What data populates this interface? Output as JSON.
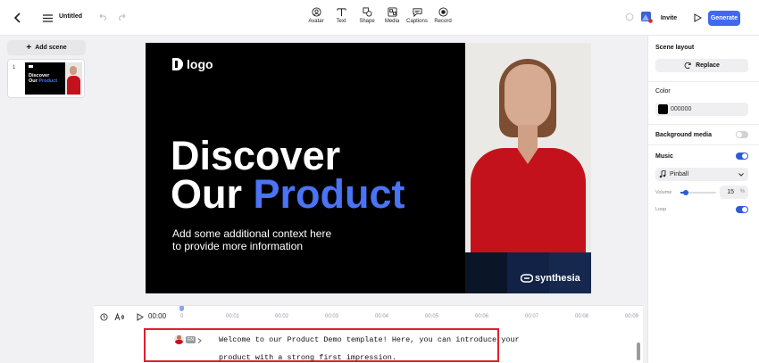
{
  "header": {
    "title": "Untitled",
    "tools": [
      {
        "label": "Avatar",
        "icon": "avatar-icon"
      },
      {
        "label": "Text",
        "icon": "text-icon"
      },
      {
        "label": "Shape",
        "icon": "shape-icon"
      },
      {
        "label": "Media",
        "icon": "media-icon"
      },
      {
        "label": "Captions",
        "icon": "captions-icon"
      },
      {
        "label": "Record",
        "icon": "record-icon"
      }
    ],
    "invite_label": "Invite",
    "generate_label": "Generate"
  },
  "sidebar": {
    "add_scene_label": "Add scene",
    "scenes": [
      {
        "number": "1",
        "line1": "Discover",
        "line2a": "Our ",
        "line2b": "Product"
      }
    ]
  },
  "slide": {
    "logo_text": "logo",
    "headline_line1": "Discover",
    "headline_line2_white": "Our ",
    "headline_line2_blue": "Product",
    "context_line1": "Add some additional context here",
    "context_line2": "to provide more information",
    "brand_text": "synthesia"
  },
  "right_panel": {
    "scene_layout_label": "Scene layout",
    "replace_label": "Replace",
    "color_label": "Color",
    "color_value": "000000",
    "background_media_label": "Background media",
    "background_media_enabled": false,
    "music_label": "Music",
    "music_enabled": true,
    "music_track": "Pinball",
    "volume_label": "Volume",
    "volume_value": "15",
    "volume_unit": "%",
    "loop_label": "Loop",
    "loop_enabled": true
  },
  "timeline": {
    "time": "00:00",
    "ticks": [
      "0",
      "00:01",
      "00:02",
      "00:03",
      "00:04",
      "00:05",
      "00:06",
      "00:07",
      "00:08",
      "00:09"
    ]
  },
  "script": {
    "language_badge": "EN",
    "line1": "Welcome to our Product Demo template! Here, you can introduce your",
    "line2": "product with a strong first impression."
  },
  "colors": {
    "accent": "#3f6af0",
    "toggle_on": "#2b5bd7",
    "slide_blue": "#4a73f5",
    "highlight_box": "#e0202a"
  }
}
